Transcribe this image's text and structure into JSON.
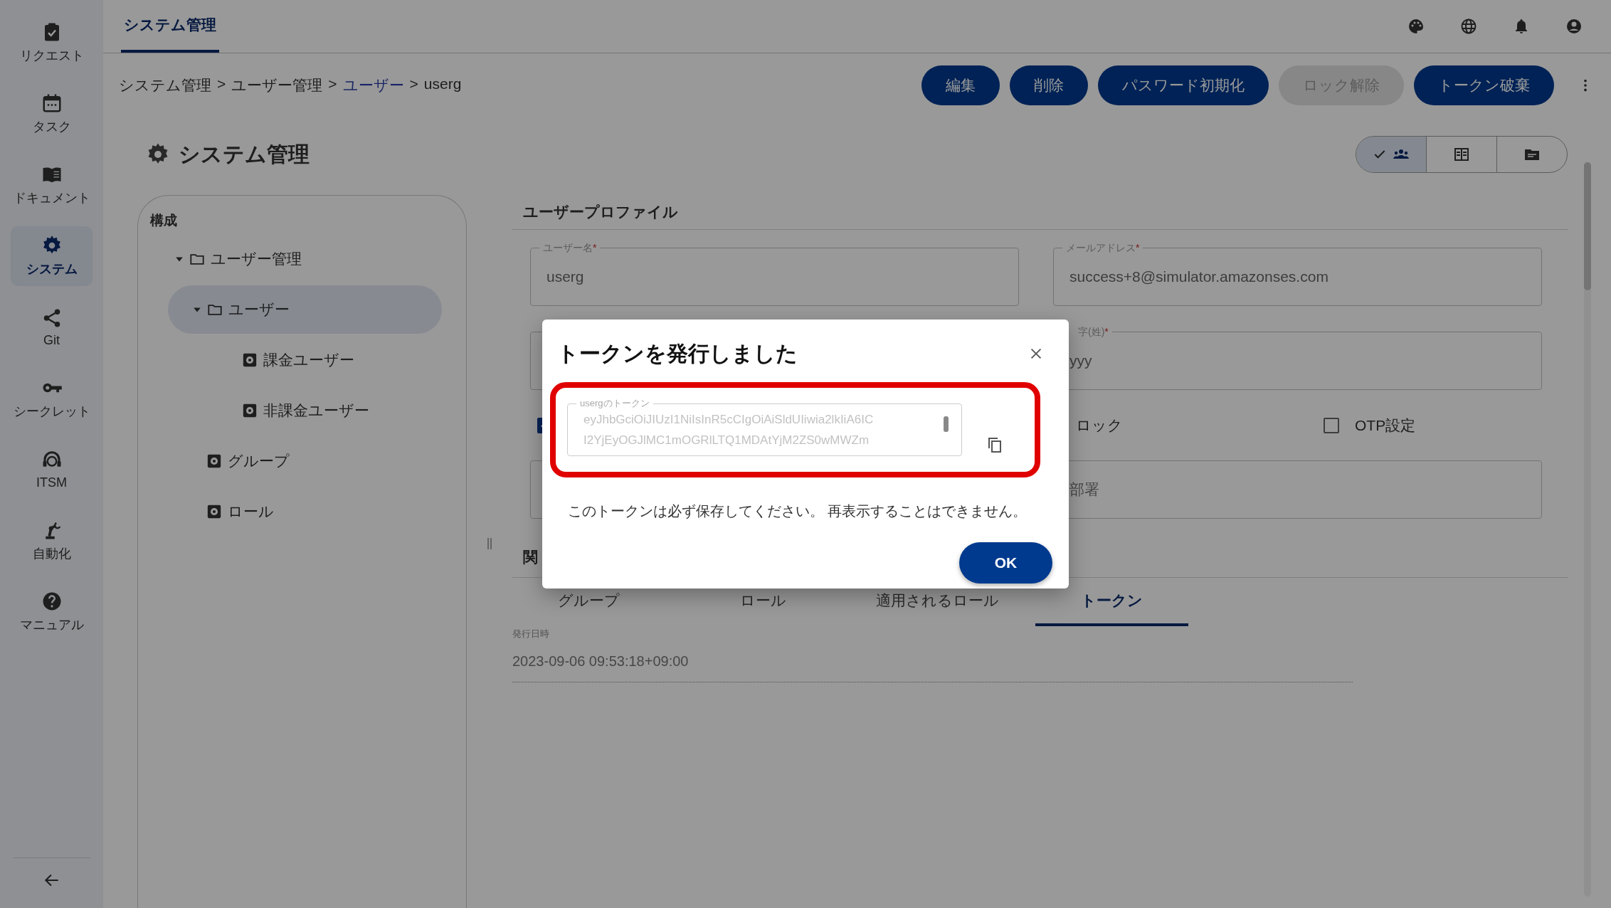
{
  "sidebar": {
    "items": [
      {
        "label": "リクエスト",
        "selected": false
      },
      {
        "label": "タスク",
        "selected": false
      },
      {
        "label": "ドキュメント",
        "selected": false
      },
      {
        "label": "システム",
        "selected": true
      },
      {
        "label": "Git",
        "selected": false
      },
      {
        "label": "シークレット",
        "selected": false
      },
      {
        "label": "ITSM",
        "selected": false
      },
      {
        "label": "自動化",
        "selected": false
      },
      {
        "label": "マニュアル",
        "selected": false
      }
    ]
  },
  "header": {
    "tabs": [
      {
        "label": "システム管理",
        "selected": true
      }
    ]
  },
  "breadcrumb": [
    {
      "kind": "crumb",
      "label": "システム管理"
    },
    {
      "kind": "sep",
      "label": ">"
    },
    {
      "kind": "crumb",
      "label": "ユーザー管理"
    },
    {
      "kind": "sep",
      "label": ">"
    },
    {
      "kind": "link",
      "label": "ユーザー"
    },
    {
      "kind": "sep",
      "label": ">"
    },
    {
      "kind": "crumb",
      "label": "userg"
    }
  ],
  "actions": [
    {
      "label": "編集",
      "disabled": false
    },
    {
      "label": "削除",
      "disabled": false
    },
    {
      "label": "パスワード初期化",
      "disabled": false
    },
    {
      "label": "ロック解除",
      "disabled": true
    },
    {
      "label": "トークン破棄",
      "disabled": false
    }
  ],
  "page_title": "システム管理",
  "view_toggle": [
    {
      "selected": true
    },
    {
      "selected": false
    },
    {
      "selected": false
    }
  ],
  "tree": {
    "heading": "構成",
    "items": [
      {
        "label": "ユーザー管理",
        "kind": "folder",
        "expanded": true,
        "selected": false,
        "children": [
          {
            "label": "ユーザー",
            "kind": "folder",
            "expanded": true,
            "selected": true,
            "children": [
              {
                "label": "課金ユーザー",
                "kind": "item",
                "selected": false
              },
              {
                "label": "非課金ユーザー",
                "kind": "item",
                "selected": false
              }
            ]
          }
        ]
      },
      {
        "label": "グループ",
        "kind": "item",
        "selected": false
      },
      {
        "label": "ロール",
        "kind": "item",
        "selected": false
      }
    ]
  },
  "profile": {
    "heading": "ユーザープロファイル",
    "rows": [
      {
        "kind": "fields",
        "fields": [
          {
            "kind": "text",
            "label": "ユーザー名",
            "required_mark": "*",
            "value": "userg"
          },
          {
            "kind": "text",
            "label": "メールアドレス",
            "required_mark": "*",
            "value": "success+8@simulator.amazonses.com"
          }
        ]
      },
      {
        "kind": "fields",
        "fields": [
          {
            "kind": "text"
          },
          {
            "kind": "text",
            "label": "字(姓)",
            "required_mark": "*",
            "value": "yyy"
          }
        ]
      },
      {
        "kind": "checks",
        "checks": [
          {
            "checked": true
          },
          {
            "label": "ロック"
          },
          {
            "label": "OTP設定",
            "checked": false
          }
        ]
      },
      {
        "kind": "fields",
        "fields": [
          {
            "kind": "text"
          },
          {
            "kind": "text",
            "placeholder": "部署"
          }
        ]
      }
    ]
  },
  "related": {
    "heading": "関",
    "tabs": [
      {
        "label": "グループ",
        "selected": false
      },
      {
        "label": "ロール",
        "selected": false
      },
      {
        "label": "適用されるロール",
        "selected": false
      },
      {
        "label": "トークン",
        "selected": true
      }
    ],
    "issued_label": "発行日時",
    "issued_value": "2023-09-06 09:53:18+09:00"
  },
  "dialog": {
    "title": "トークンを発行しました",
    "token_label": "usergのトークン",
    "token_lines": [
      "eyJhbGciOiJIUzI1NiIsInR5cCIgOiAiSldUIiwia2lkIiA6IC",
      "I2YjEyOGJlMC1mOGRlLTQ1MDAtYjM2ZS0wMWZm"
    ],
    "message": "このトークンは必ず保存してください。 再表示することはできません。",
    "ok": "OK"
  }
}
